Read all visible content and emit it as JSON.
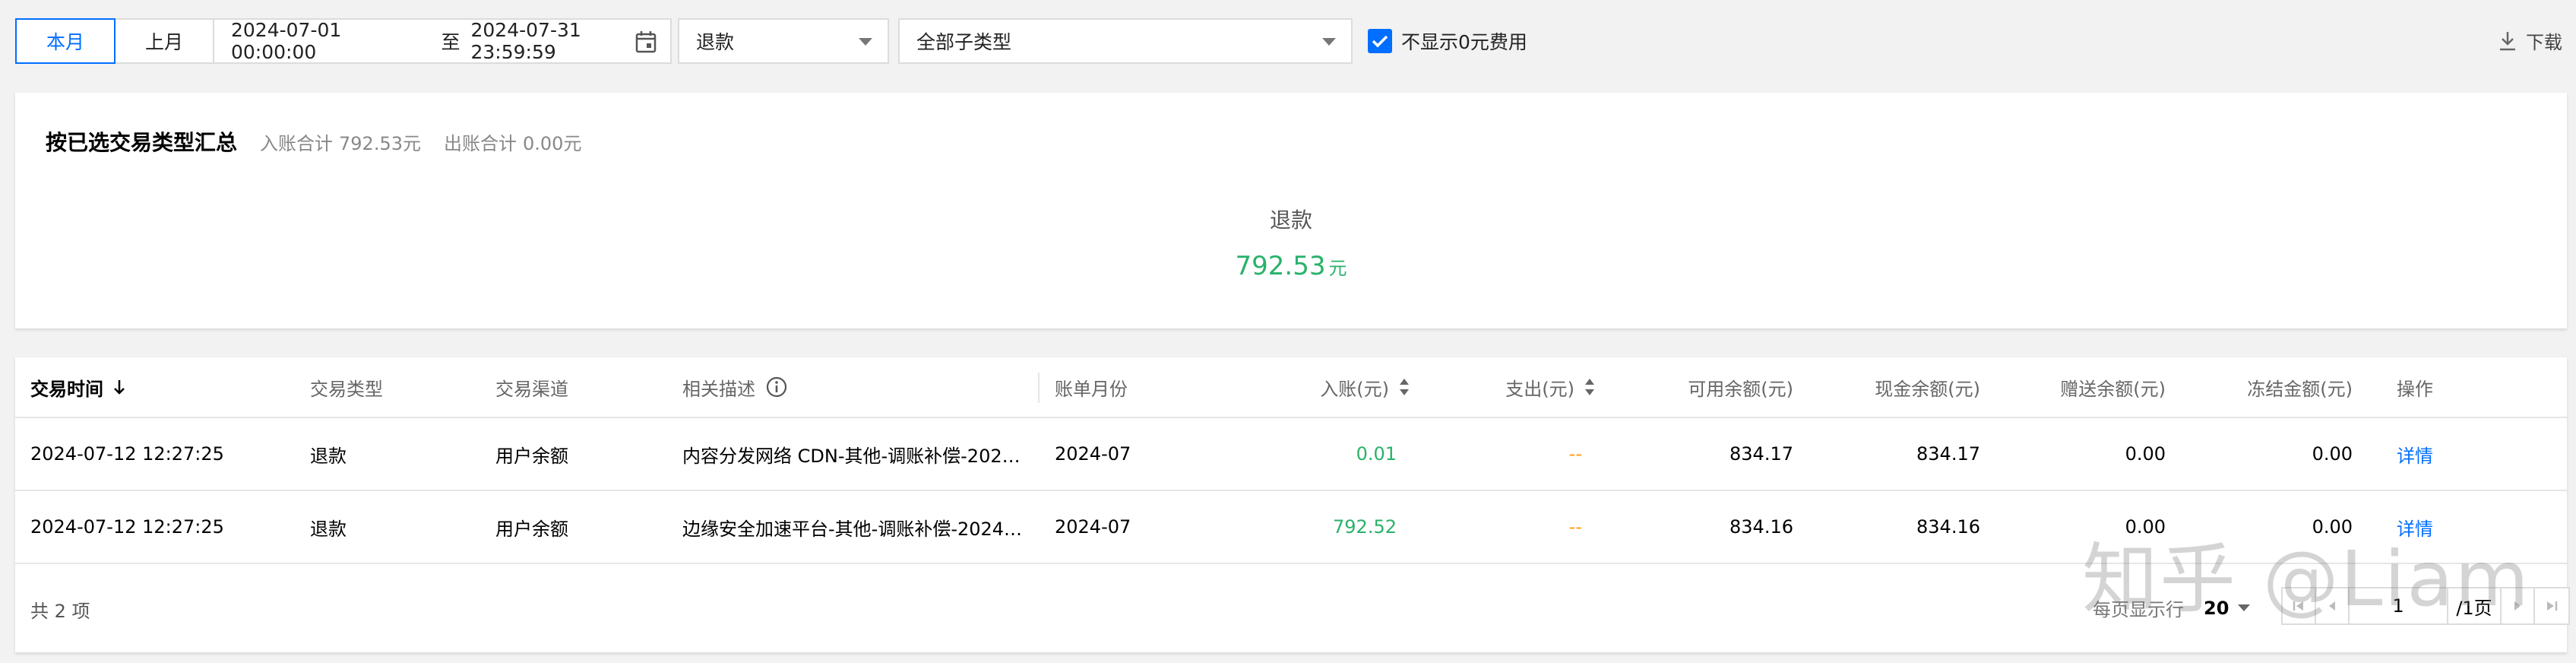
{
  "toolbar": {
    "this_month": "本月",
    "last_month": "上月",
    "date_start": "2024-07-01 00:00:00",
    "date_sep": "至",
    "date_end": "2024-07-31 23:59:59",
    "type_select": "退款",
    "subtype_select": "全部子类型",
    "hide_zero_label": "不显示0元费用",
    "hide_zero_checked": true,
    "download_label": "下载"
  },
  "summary": {
    "title": "按已选交易类型汇总",
    "income_label": "入账合计",
    "income_value": "792.53元",
    "expense_label": "出账合计",
    "expense_value": "0.00元",
    "category": "退款",
    "amount": "792.53",
    "unit": "元"
  },
  "table": {
    "headers": {
      "time": "交易时间",
      "type": "交易类型",
      "channel": "交易渠道",
      "desc": "相关描述",
      "month": "账单月份",
      "income": "入账(元)",
      "expense": "支出(元)",
      "available": "可用余额(元)",
      "cash": "现金余额(元)",
      "gift": "赠送余额(元)",
      "frozen": "冻结金额(元)",
      "action": "操作"
    },
    "rows": [
      {
        "time": "2024-07-12 12:27:25",
        "type": "退款",
        "channel": "用户余额",
        "desc": "内容分发网络 CDN-其他-调账补偿-202…",
        "month": "2024-07",
        "income": "0.01",
        "expense": "--",
        "available": "834.17",
        "cash": "834.17",
        "gift": "0.00",
        "frozen": "0.00",
        "action": "详情"
      },
      {
        "time": "2024-07-12 12:27:25",
        "type": "退款",
        "channel": "用户余额",
        "desc": "边缘安全加速平台-其他-调账补偿-2024…",
        "month": "2024-07",
        "income": "792.52",
        "expense": "--",
        "available": "834.16",
        "cash": "834.16",
        "gift": "0.00",
        "frozen": "0.00",
        "action": "详情"
      }
    ],
    "footer": {
      "total": "共 2 项",
      "per_page_label": "每页显示行",
      "per_page_value": "20",
      "page_input": "1",
      "page_total": "/1页"
    }
  },
  "watermark": "知乎 @Liam",
  "colors": {
    "accent": "#006eff",
    "income_green": "#29b26a",
    "dash_orange": "#ff9c19"
  }
}
